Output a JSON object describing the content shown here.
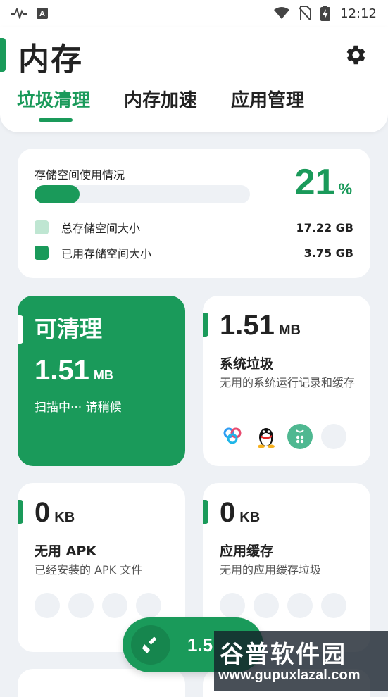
{
  "status_bar": {
    "time": "12:12"
  },
  "header": {
    "title": "内存",
    "tabs": [
      {
        "label": "垃圾清理",
        "active": true
      },
      {
        "label": "内存加速",
        "active": false
      },
      {
        "label": "应用管理",
        "active": false
      }
    ]
  },
  "storage": {
    "label": "存储空间使用情况",
    "percent": "21",
    "percent_unit": "%",
    "used_fraction": 0.21,
    "total_label": "总存储空间大小",
    "total_value": "17.22 GB",
    "used_label": "已用存储空间大小",
    "used_value": "3.75 GB"
  },
  "clean": {
    "title": "可清理",
    "size_value": "1.51",
    "size_unit": "MB",
    "status": "扫描中··· 请稍候"
  },
  "system_junk": {
    "size_value": "1.51",
    "size_unit": "MB",
    "name": "系统垃圾",
    "desc": "无用的系统运行记录和缓存"
  },
  "apk": {
    "size_value": "0",
    "size_unit": "KB",
    "name": "无用 APK",
    "desc": "已经安装的 APK 文件"
  },
  "cache": {
    "size_value": "0",
    "size_unit": "KB",
    "name": "应用缓存",
    "desc": "无用的应用缓存垃圾"
  },
  "fab": {
    "label": "1.5"
  },
  "watermark": {
    "line1": "谷普软件园",
    "line2": "www.gupuxlazal.com"
  },
  "colors": {
    "accent": "#1A9A5A",
    "legend_total": "#BFE6D2",
    "background": "#EEF1F5"
  }
}
